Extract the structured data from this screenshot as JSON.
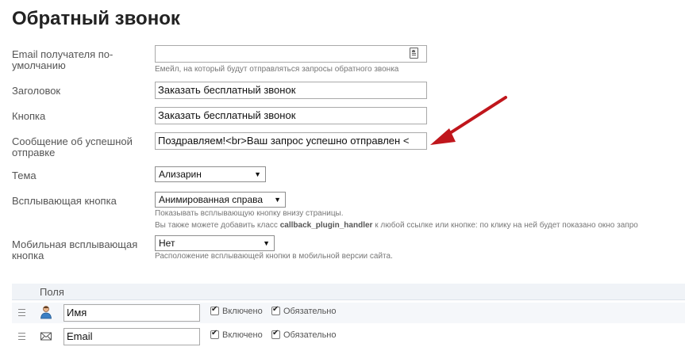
{
  "page": {
    "title": "Обратный звонок"
  },
  "form": {
    "email": {
      "label": "Email получателя по-умолчанию",
      "value": "",
      "hint": "Емейл, на который будут отправляться запросы обратного звонка"
    },
    "header": {
      "label": "Заголовок",
      "value": "Заказать бесплатный звонок"
    },
    "button": {
      "label": "Кнопка",
      "value": "Заказать бесплатный звонок"
    },
    "success": {
      "label": "Сообщение об успешной отправке",
      "value": "Поздравляем!<br>Ваш запрос успешно отправлен <"
    },
    "theme": {
      "label": "Тема",
      "value": "Ализарин"
    },
    "popup": {
      "label": "Всплывающая кнопка",
      "value": "Анимированная справа",
      "hint1": "Показывать всплывающую кнопку внизу страницы.",
      "hint2_pre": "Вы также можете добавить класс ",
      "hint2_code": "callback_plugin_handler",
      "hint2_post": " к любой ссылке или кнопке: по клику на ней будет показано окно запро"
    },
    "mobile": {
      "label": "Мобильная всплывающая кнопка",
      "value": "Нет",
      "hint": "Расположение всплывающей кнопки в мобильной версии сайта."
    }
  },
  "fields": {
    "header": "Поля",
    "rows": [
      {
        "name": "Имя",
        "icon": "person-icon",
        "enabled": "Включено",
        "required": "Обязательно"
      },
      {
        "name": "Email",
        "icon": "envelope-icon",
        "enabled": "Включено",
        "required": "Обязательно"
      }
    ]
  },
  "colors": {
    "arrow": "#c0161c",
    "header_bg": "#f0f3f7"
  }
}
